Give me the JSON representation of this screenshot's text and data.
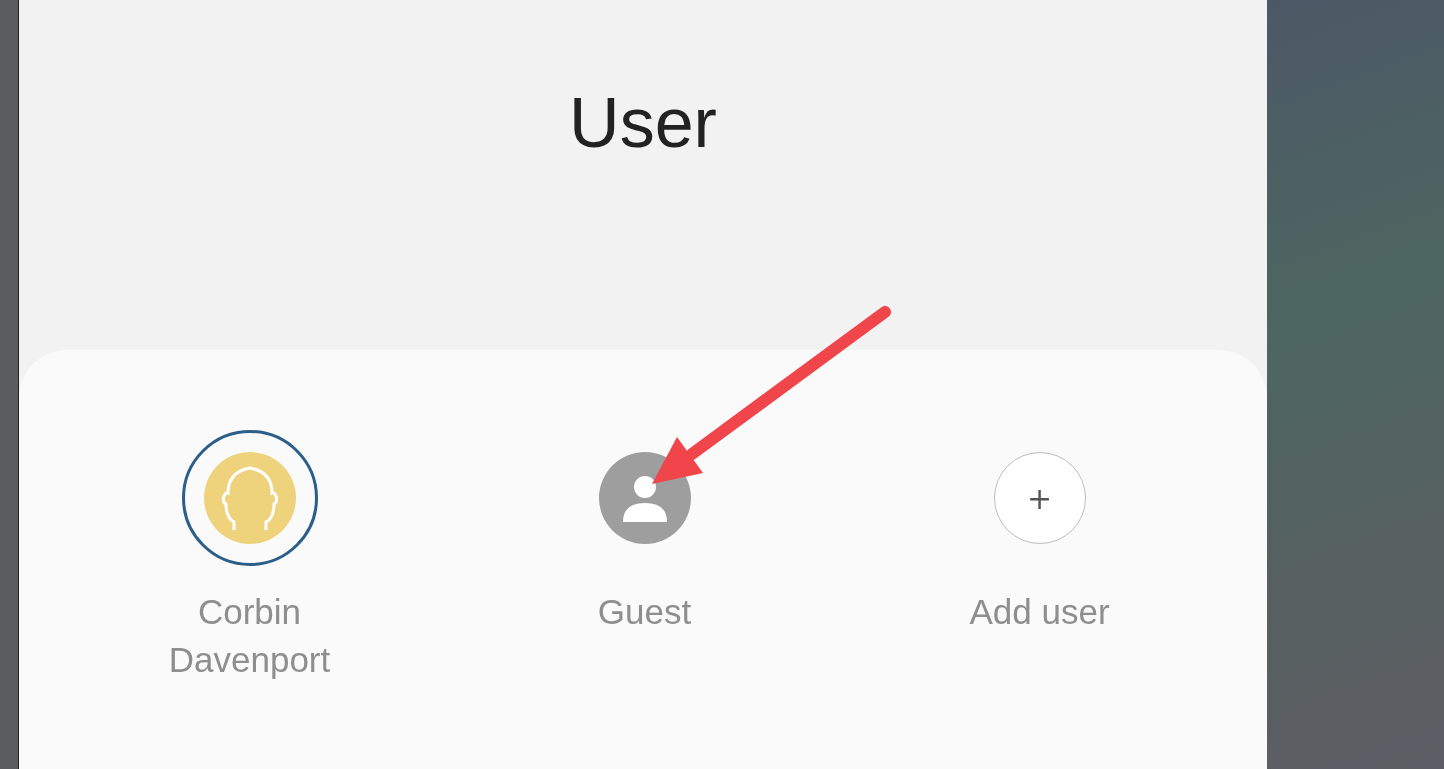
{
  "title": "User",
  "users": [
    {
      "kind": "profile",
      "name": "Corbin Davenport",
      "selected": true
    },
    {
      "kind": "guest",
      "name": "Guest",
      "selected": false
    },
    {
      "kind": "add",
      "name": "Add user",
      "symbol": "+",
      "selected": false
    }
  ]
}
